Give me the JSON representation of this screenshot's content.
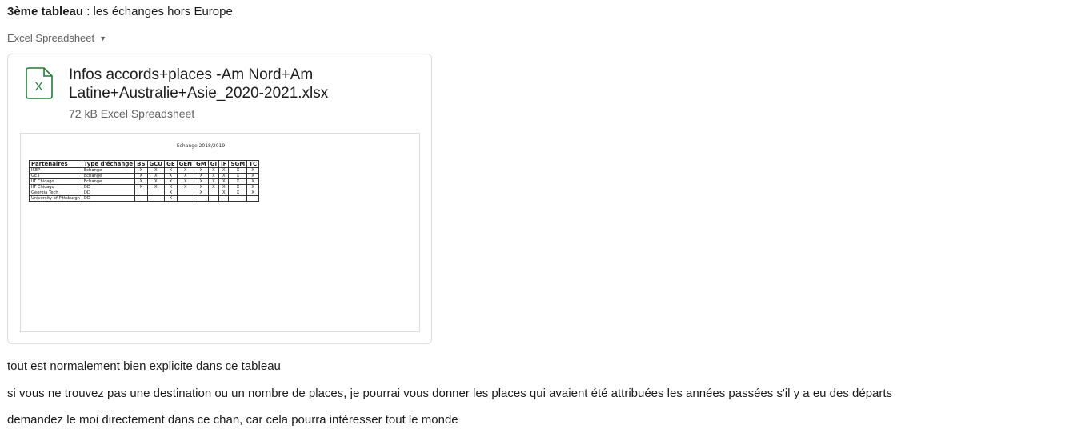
{
  "message": {
    "heading_bold": "3ème tableau",
    "heading_rest": " : les échanges hors Europe",
    "file_type_label": "Excel Spreadsheet",
    "lines": [
      "tout est normalement bien explicite dans ce tableau",
      "si vous ne trouvez pas une destination ou un nombre de places, je pourrai vous donner les places qui avaient été attribuées les années passées s'il y a eu des départs",
      "demandez le moi directement dans ce chan, car cela pourra intéresser tout le monde"
    ]
  },
  "attachment": {
    "icon": "excel-file-icon",
    "icon_letter": "X",
    "icon_color": "#1e7e34",
    "title": "Infos accords+places -Am Nord+Am Latine+Australie+Asie_2020-2021.xlsx",
    "meta": "72 kB Excel Spreadsheet",
    "preview": {
      "title": "Echange 2018/2019",
      "headers": [
        "Partenaires",
        "Type d'échange",
        "BS",
        "GCU",
        "GE",
        "GEN",
        "GM",
        "GI",
        "IF",
        "SGM",
        "TC"
      ],
      "rows": [
        [
          "ISEP",
          "Echange",
          "X",
          "X",
          "X",
          "X",
          "X",
          "X",
          "X",
          "X",
          "X"
        ],
        [
          "GE3",
          "Echange",
          "X",
          "X",
          "X",
          "X",
          "X",
          "X",
          "X",
          "X",
          "X"
        ],
        [
          "IIT Chicago",
          "Echange",
          "X",
          "X",
          "X",
          "X",
          "X",
          "X",
          "X",
          "X",
          "X"
        ],
        [
          "IIT Chicago",
          "DD",
          "X",
          "X",
          "X",
          "X",
          "X",
          "X",
          "X",
          "X",
          "X"
        ],
        [
          "Georgia Tech",
          "DD",
          "",
          "",
          "X",
          "",
          "X",
          "",
          "X",
          "X",
          "X"
        ],
        [
          "University of Pittsburgh",
          "DD",
          "",
          "",
          "X",
          "",
          "",
          "",
          "",
          "",
          ""
        ]
      ]
    }
  }
}
